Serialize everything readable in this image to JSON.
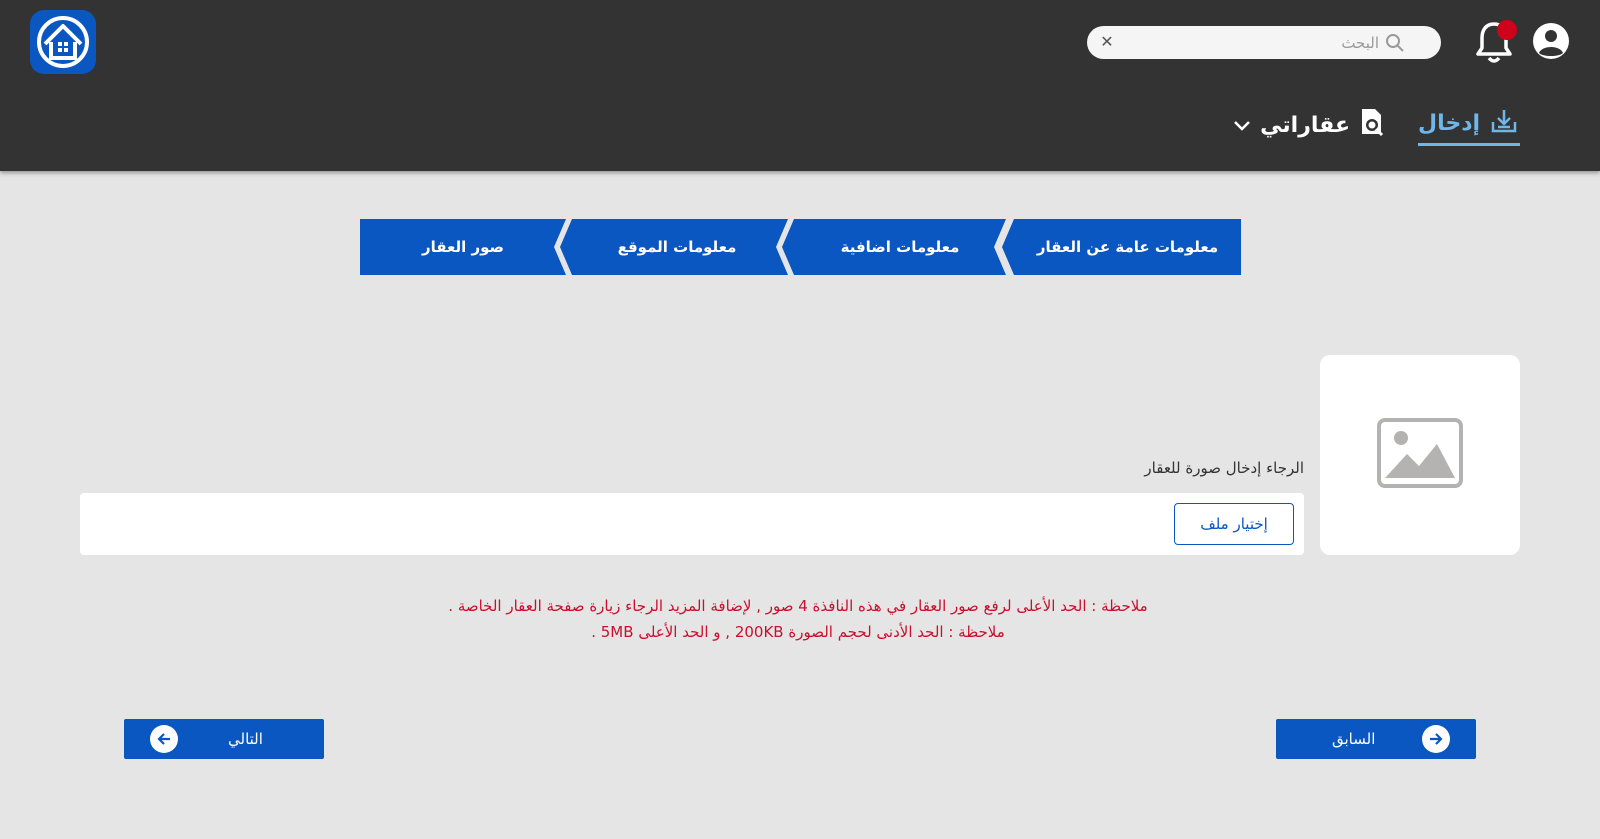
{
  "header": {
    "search": {
      "placeholder": "البحث",
      "value": ""
    },
    "nav": {
      "enter_label": "إدخال",
      "my_properties_label": "عقاراتي"
    }
  },
  "steps": [
    {
      "label": "معلومات عامة عن العقار"
    },
    {
      "label": "معلومات اضافية"
    },
    {
      "label": "معلومات الموقع"
    },
    {
      "label": "صور العقار"
    }
  ],
  "upload": {
    "label": "الرجاء إدخال صورة للعقار",
    "choose_file_label": "إختيار ملف"
  },
  "notes": {
    "max_images": "ملاحظة : الحد الأعلى لرفع صور العقار في هذه النافذة 4 صور , لإضافة المزيد الرجاء زيارة صفحة العقار الخاصة .",
    "size_limits": "ملاحظة : الحد الأدنى لحجم الصورة 200KB , و الحد الأعلى 5MB ."
  },
  "buttons": {
    "next_label": "التالي",
    "prev_label": "السابق"
  },
  "colors": {
    "primary": "#0a57c1",
    "header_bg": "#333333",
    "accent": "#6fb6ea",
    "note": "#c8102e",
    "page_bg": "#e5e5e5"
  }
}
